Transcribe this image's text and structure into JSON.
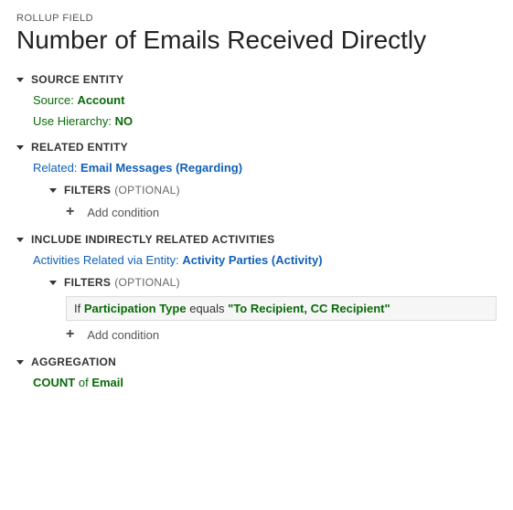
{
  "breadcrumb": "ROLLUP FIELD",
  "title": "Number of Emails Received Directly",
  "sections": {
    "source": {
      "header": "SOURCE ENTITY",
      "sourceLabel": "Source:",
      "sourceValue": "Account",
      "hierarchyLabel": "Use Hierarchy:",
      "hierarchyValue": "NO"
    },
    "related": {
      "header": "RELATED ENTITY",
      "relLabel": "Related:",
      "relEntity": "Email Messages",
      "relParen": "Regarding",
      "filtersHeader": "FILTERS",
      "filtersOptional": "(OPTIONAL)",
      "addCondition": "Add condition"
    },
    "indirect": {
      "header": "INCLUDE INDIRECTLY RELATED ACTIVITIES",
      "viaLabel": "Activities Related via Entity:",
      "viaEntity": "Activity Parties",
      "viaParen": "Activity",
      "filtersHeader": "FILTERS",
      "filtersOptional": "(OPTIONAL)",
      "cond": {
        "if": "If",
        "field": "Participation Type",
        "op": "equals",
        "val": "\"To Recipient, CC Recipient\""
      },
      "addCondition": "Add condition"
    },
    "aggregation": {
      "header": "AGGREGATION",
      "func": "COUNT",
      "of": "of",
      "field": "Email"
    }
  }
}
